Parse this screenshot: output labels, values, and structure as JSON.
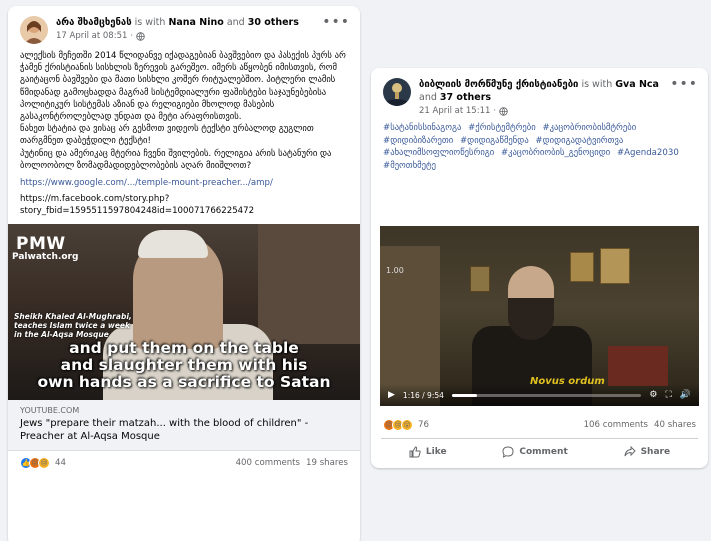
{
  "post1": {
    "author": "არა შხამცხენას",
    "with_text": "is with",
    "tag1": "Nana Nino",
    "and_text": "and",
    "others": "30 others",
    "date": "17 April at 08:51",
    "date_sep": "·",
    "body_p1": "ალექსის მეჩეთში 2014 წლიდანვე იქადაგებიან ბავშვებიო და პასექის პურს არ ჭამენ ქრისტიანის სისხლის ზერევის გარეშეო. იმერს აწყობენ იმისთვის, რომ გაიტაცონ ბავშვები და მათი სისხლი კოშერ რიტუალებშიო. პიტლერი ლამის წმიდანად გამოცხადდა მაგრამ სისტემდიალური ფაშისტები საჯაუნებებისა პოლიტიკურ სისტემას აზიან და რელიგიები მხოლოდ მასების გასაკონტროლებლად უნდათ და მეტი არაფრისთვის.",
    "body_p2": "ნახეთ სტატია და ვისაც არ გესმოთ ვიდეოს ტექსტი ურბალოდ გუგლით თარგმნეთ დაბეჭდილი ტექსტი!",
    "body_p3": "პუტინიც და ამერიკაც მტერია ჩვენი შვილების. რელიგია არის სატანური და ბოლოობოლ ზომადმადიდებლობების აღარ მიიშლოთ?",
    "link": "https://www.google.com/.../temple-mount-preacher.../amp/",
    "plain_link": "https://m.facebook.com/story.php?story_fbid=1595511597804248id=100071766225472",
    "video": {
      "pmw": "PMW",
      "pmw_sub": "Palwatch.org",
      "caption": "Sheikh Khaled Al-Mughrabi, teaches Islam twice a week in the Al-Aqsa Mosque",
      "sub1": "and put them on the table",
      "sub2": "and slaughter them with his",
      "sub3": "own hands as a sacrifice to Satan"
    },
    "link_domain": "YOUTUBE.COM",
    "link_title": "Jews \"prepare their matzah... with the blood of children\" - Preacher at Al-Aqsa Mosque",
    "reactions_count": "44",
    "comments": "400 comments",
    "shares": "19 shares"
  },
  "post2": {
    "author": "ბიბლიის მორწმუნე ქრისტიანები",
    "with_text": "is with",
    "tag1": "Gva Nca",
    "and_text": "and",
    "others": "37 others",
    "date": "21 April at 15:11",
    "date_sep": "·",
    "hashtags": [
      "#სატანისსინაგოგა",
      "#ქრისტემტრები",
      "#კაცობრიობისმტრები",
      "#დიდიბიზარეთი",
      "#დიდიგაწმენდა",
      "#დიდიგადატვირთვა",
      "#ახალიმსოფლიოწესრიგი",
      "#კაცობრიობის_გენოციდი",
      "#Agenda2030",
      "#მეოთხმეტე"
    ],
    "video": {
      "sign": "1.00",
      "watermark": "Novus ordum",
      "time": "1:16 / 9:54",
      "progress": 0.13
    },
    "reactions_count": "76",
    "comments": "106 comments",
    "shares": "40 shares",
    "like_label": "Like",
    "comment_label": "Comment",
    "share_label": "Share"
  },
  "colors": {
    "link": "#385898",
    "like_blue": "#1877f2",
    "muted": "#65676b"
  }
}
